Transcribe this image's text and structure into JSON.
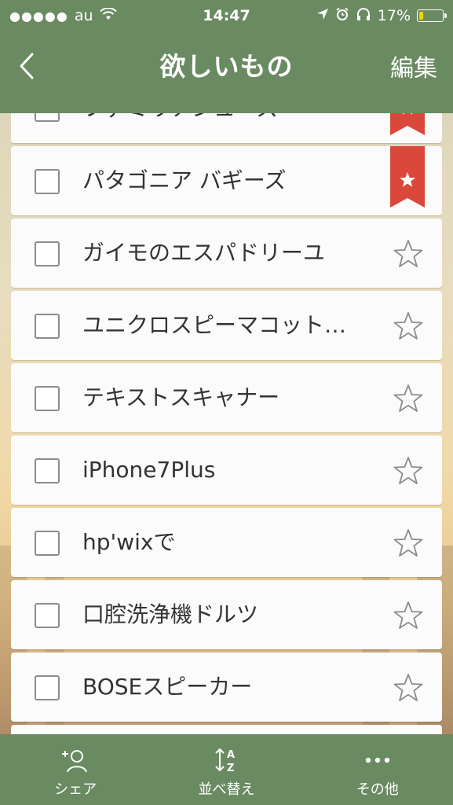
{
  "status_bar": {
    "signal": "●●●●●",
    "carrier": "au",
    "time": "14:47",
    "battery": "17%",
    "battery_level": 0.17
  },
  "nav": {
    "back_icon": "chevron-left-icon",
    "title": "欲しいもの",
    "edit_label": "編集"
  },
  "items": [
    {
      "label": "ファミリアシューズ",
      "starred": true
    },
    {
      "label": "パタゴニア バギーズ",
      "starred": true
    },
    {
      "label": "ガイモのエスパドリーユ",
      "starred": false
    },
    {
      "label": "ユニクロスピーマコット…",
      "starred": false
    },
    {
      "label": "テキストスキャナー",
      "starred": false
    },
    {
      "label": "iPhone7Plus",
      "starred": false
    },
    {
      "label": "hp'wixで",
      "starred": false
    },
    {
      "label": "口腔洗浄機ドルツ",
      "starred": false
    },
    {
      "label": "BOSEスピーカー",
      "starred": false
    },
    {
      "label": "",
      "starred": false
    }
  ],
  "tab_bar": {
    "tabs": [
      {
        "label": "シェア",
        "icon": "add-person-icon"
      },
      {
        "label": "並べ替え",
        "icon": "sort-az-icon"
      },
      {
        "label": "その他",
        "icon": "more-dots-icon"
      }
    ]
  },
  "colors": {
    "bar": "#6a8a62",
    "ribbon": "#d9483b",
    "star_outline": "#8c8c8c"
  }
}
